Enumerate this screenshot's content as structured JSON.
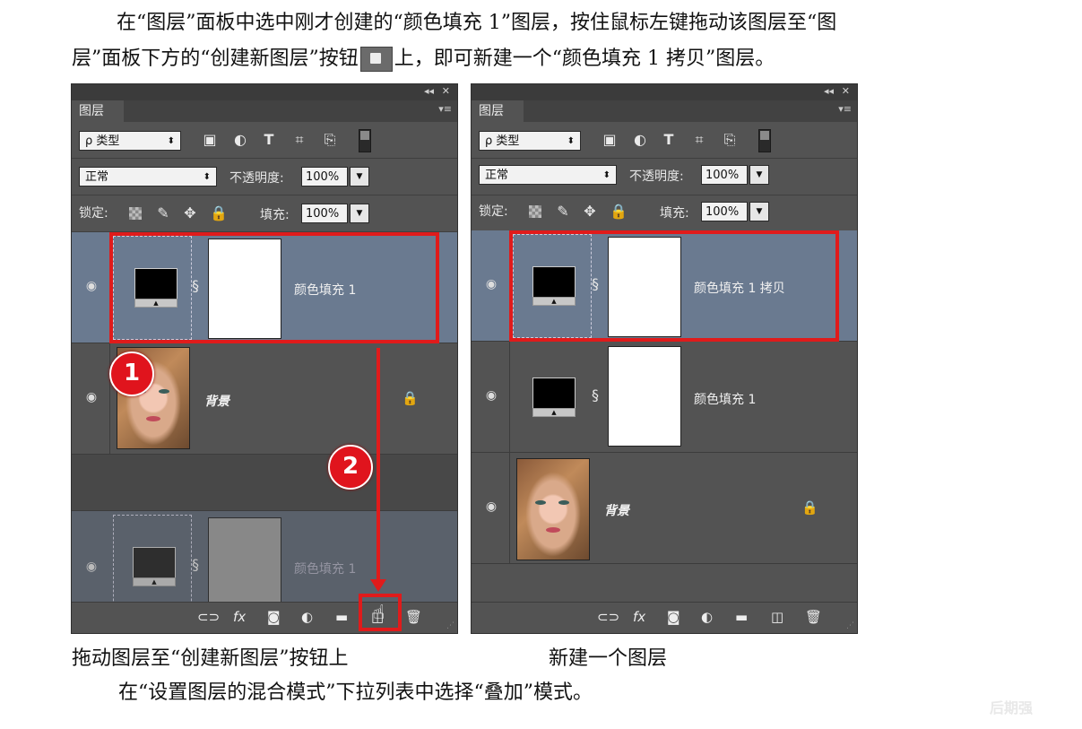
{
  "paragraph1": {
    "line1": "在“图层”面板中选中刚才创建的“颜色填充 1”图层，按住鼠标左键拖动该图层至“图",
    "line2_before": "层”面板下方的“创建新图层”按钮",
    "line2_after": "上，即可新建一个“颜色填充 1 拷贝”图层。"
  },
  "panel_common": {
    "tab": "图层",
    "filter_kind": "ρ 类型",
    "blend_mode": "正常",
    "opacity_label": "不透明度:",
    "opacity_value": "100%",
    "lock_label": "锁定:",
    "fill_label": "填充:",
    "fill_value": "100%",
    "collapse_icon": "◂◂",
    "close_icon": "✕",
    "menu_icon": "▾≡"
  },
  "left_panel": {
    "layers": [
      {
        "name": "颜色填充 1",
        "selected": true,
        "type": "fill"
      },
      {
        "name": "背景",
        "selected": false,
        "type": "photo",
        "locked": true
      },
      {
        "name": "颜色填充 1",
        "selected": false,
        "type": "drag-ghost"
      }
    ],
    "badge1": "1",
    "badge2": "2"
  },
  "right_panel": {
    "layers": [
      {
        "name": "颜色填充 1 拷贝",
        "selected": true,
        "type": "fill"
      },
      {
        "name": "颜色填充 1",
        "selected": false,
        "type": "fill"
      },
      {
        "name": "背景",
        "selected": false,
        "type": "photo",
        "locked": true
      }
    ]
  },
  "captions": {
    "left": "拖动图层至“创建新图层”按钮上",
    "right": "新建一个图层"
  },
  "paragraph3": "在“设置图层的混合模式”下拉列表中选择“叠加”模式。",
  "watermark": "后期强",
  "colors": {
    "highlight": "#e01b1b",
    "selected_layer": "#6a7a90",
    "panel_bg": "#535353"
  }
}
